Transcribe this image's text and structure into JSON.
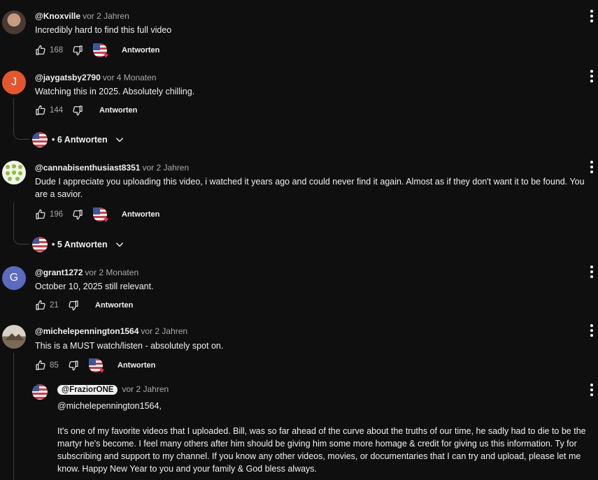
{
  "comments": [
    {
      "handle": "@Knoxville",
      "time": "vor 2 Jahren",
      "text": "Incredibly hard to find this full video",
      "likes": "168",
      "reply_label": "Antworten"
    },
    {
      "handle": "@jaygatsby2790",
      "time": "vor 4 Monaten",
      "avatar_letter": "J",
      "text": "Watching this in 2025. Absolutely chilling.",
      "likes": "144",
      "reply_label": "Antworten",
      "replies_label": "• 6 Antworten"
    },
    {
      "handle": "@cannabisenthusiast8351",
      "time": "vor 2 Jahren",
      "text": "Dude I appreciate you uploading this video, i watched it years ago and could never find it again. Almost as if they don't want it to be found. You are a savior.",
      "likes": "196",
      "reply_label": "Antworten",
      "replies_label": "• 5 Antworten"
    },
    {
      "handle": "@grant1272",
      "time": "vor 2 Monaten",
      "avatar_letter": "G",
      "text": "October 10, 2025 still relevant.",
      "likes": "21",
      "reply_label": "Antworten"
    },
    {
      "handle": "@michelepennington1564",
      "time": "vor 2 Jahren",
      "text": "This is a MUST watch/listen - absolutely spot on.",
      "likes": "85",
      "reply_label": "Antworten"
    }
  ],
  "reply": {
    "handle": "@FraziorONE",
    "time": "vor 2 Jahren",
    "mention": "@michelepennington1564,",
    "text": "It's one of my favorite videos that I uploaded. Bill, was so far ahead of the curve about the truths of our time, he sadly had to die to be the martyr he's become. I feel many others after him should be giving him some more homage & credit for giving us this information. Ty for subscribing and support to my channel. If you know any other videos, movies, or documentaries that I can try and upload, please let me know. Happy New Year to you and your family & God bless always."
  },
  "colors": {
    "background": "#0f0f0f",
    "heart": "#ff2d55",
    "avatar_j": "#e4572e",
    "avatar_g": "#5c6bc0"
  },
  "icons": [
    "like-icon",
    "dislike-icon",
    "more-vert-icon",
    "chevron-down-icon",
    "heart-icon"
  ]
}
